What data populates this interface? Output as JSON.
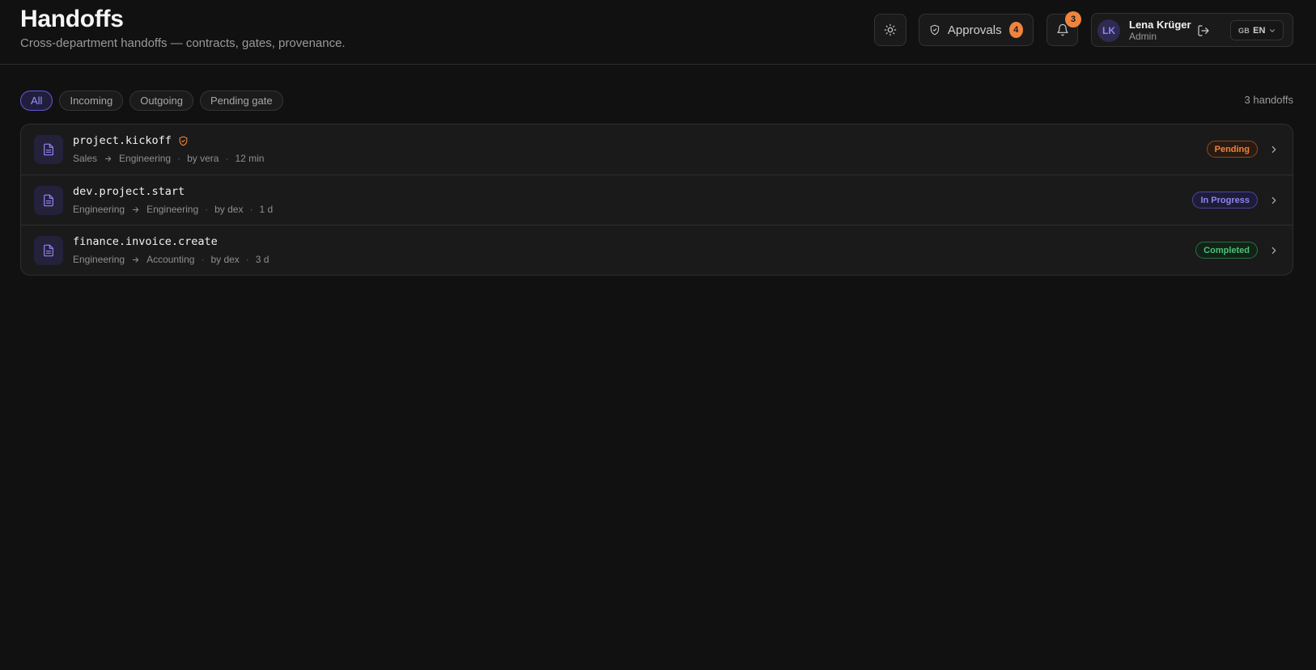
{
  "header": {
    "title": "Handoffs",
    "subtitle": "Cross-department handoffs — contracts, gates, provenance.",
    "approvals_label": "Approvals",
    "approvals_count": "4",
    "notifications_count": "3"
  },
  "user": {
    "initials": "LK",
    "name": "Lena Krüger",
    "role": "Admin",
    "lang_flag": "GB",
    "lang_code": "EN"
  },
  "filters": {
    "all": "All",
    "incoming": "Incoming",
    "outgoing": "Outgoing",
    "pending_gate": "Pending gate",
    "active": "All"
  },
  "count_text": "3 handoffs",
  "handoffs": [
    {
      "title": "project.kickoff",
      "gated": true,
      "from": "Sales",
      "to": "Engineering",
      "by": "by vera",
      "age": "12 min",
      "status": "Pending"
    },
    {
      "title": "dev.project.start",
      "gated": false,
      "from": "Engineering",
      "to": "Engineering",
      "by": "by dex",
      "age": "1 d",
      "status": "In Progress"
    },
    {
      "title": "finance.invoice.create",
      "gated": false,
      "from": "Engineering",
      "to": "Accounting",
      "by": "by dex",
      "age": "3 d",
      "status": "Completed"
    }
  ],
  "colors": {
    "background": "#111111",
    "accent": "#8f85f0",
    "pending": "#f0843e",
    "in_progress": "#8f85f0",
    "completed": "#4cc373"
  },
  "icons": [
    "sun-icon",
    "shield-check-icon",
    "bell-icon",
    "logout-icon",
    "chevron-down-icon",
    "document-icon",
    "arrow-right-icon",
    "chevron-right-icon"
  ]
}
